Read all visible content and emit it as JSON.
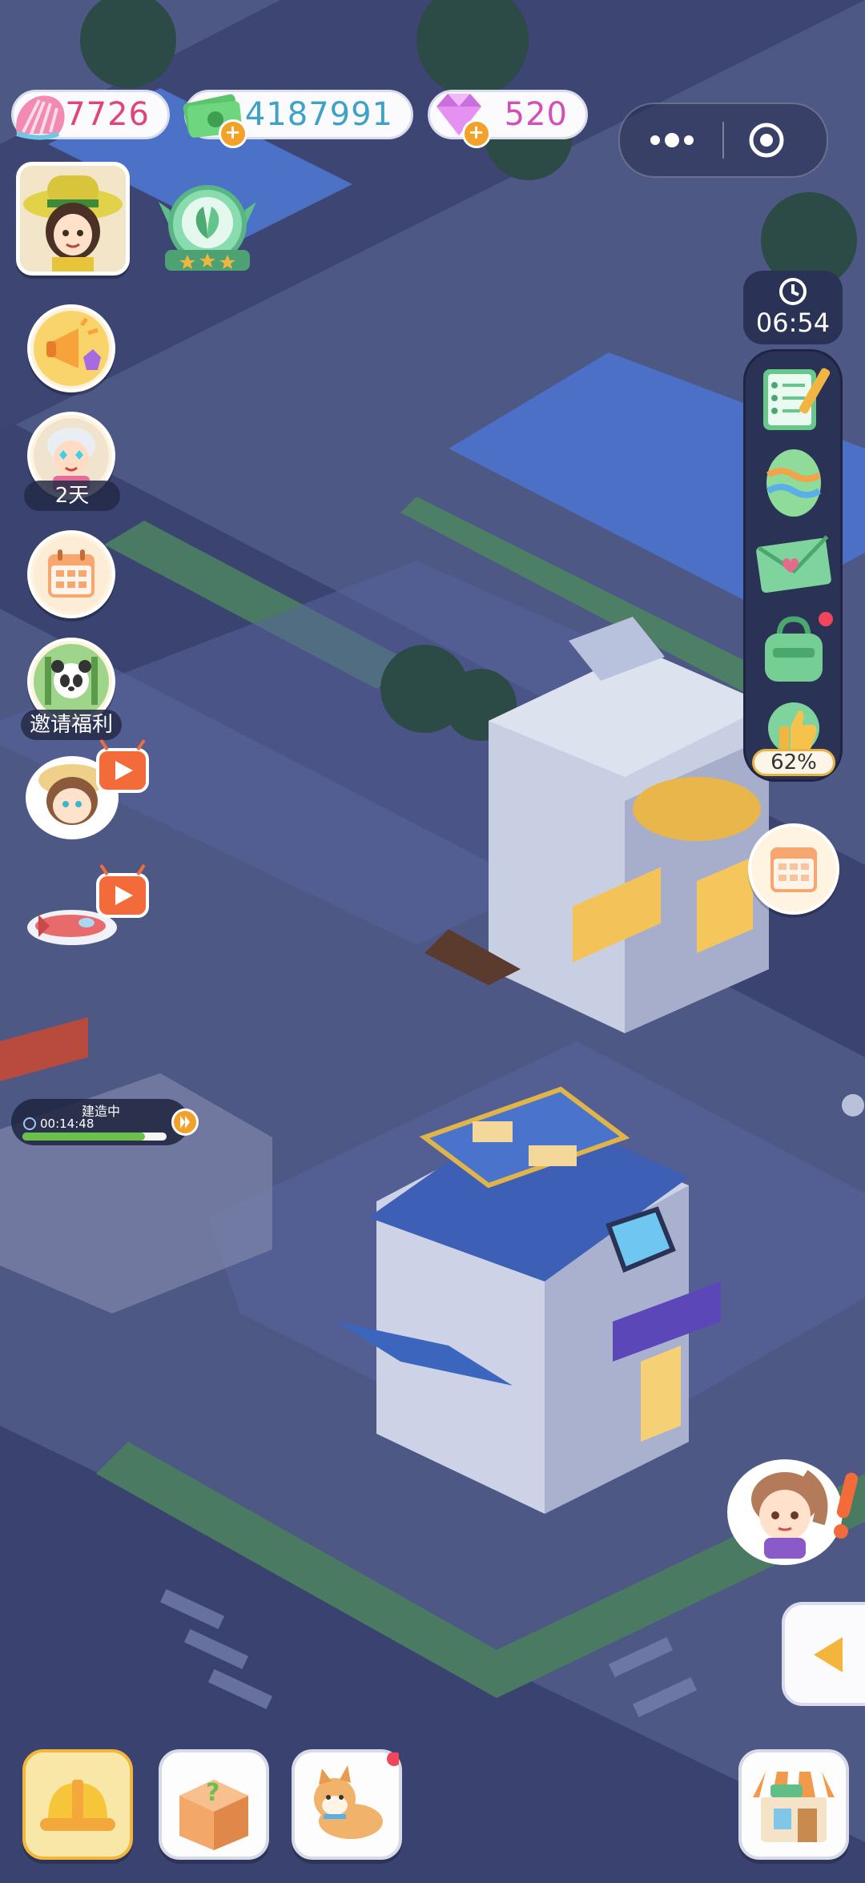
{
  "currencies": {
    "shells": {
      "icon": "shell-icon",
      "value": "7726"
    },
    "cash": {
      "icon": "banknote-icon",
      "value": "4187991"
    },
    "gems": {
      "icon": "gem-icon",
      "value": "520"
    }
  },
  "mini_program": {
    "menu_icon": "more-dots-icon",
    "close_icon": "target-close-icon"
  },
  "left_menu": {
    "avatar_icon": "player-avatar-icon",
    "badge_icon": "leaf-rank-badge-icon",
    "announcement_icon": "megaphone-icon",
    "event": {
      "icon": "character-event-icon",
      "tag": "2天"
    },
    "calendar_icon": "calendar-icon",
    "invite": {
      "icon": "panda-invite-icon",
      "tag": "邀请福利"
    },
    "video_ad_1": "video-reward-girl-icon",
    "video_ad_2": "video-reward-plane-icon"
  },
  "right_menu": {
    "timer": {
      "icon": "clock-icon",
      "value": "06:54"
    },
    "tasks_icon": "task-notepad-icon",
    "egg_icon": "egg-icon",
    "mail_icon": "mail-icon",
    "bag_icon": "bag-icon",
    "rating": {
      "icon": "thumbs-up-icon",
      "value": "62%"
    },
    "calendar_bubble_icon": "calendar-bubble-icon",
    "npc_alert_icon": "npc-alert-icon",
    "collapse_icon": "arrow-left-icon"
  },
  "construction": {
    "label": "建造中",
    "time": "00:14:48",
    "progress": 0.85,
    "speedup_icon": "speedup-icon"
  },
  "bottom_bar": {
    "build_icon": "hardhat-icon",
    "mystery_icon": "mystery-box-icon",
    "pet_icon": "shiba-dog-icon",
    "shop_icon": "shop-icon"
  },
  "colors": {
    "shell_text": "#e0447a",
    "cash_text": "#3ea2c6",
    "gem_text": "#d24fb7",
    "panel": "#2a3256",
    "accent": "#f4a12a",
    "ground": "#4a5580"
  }
}
